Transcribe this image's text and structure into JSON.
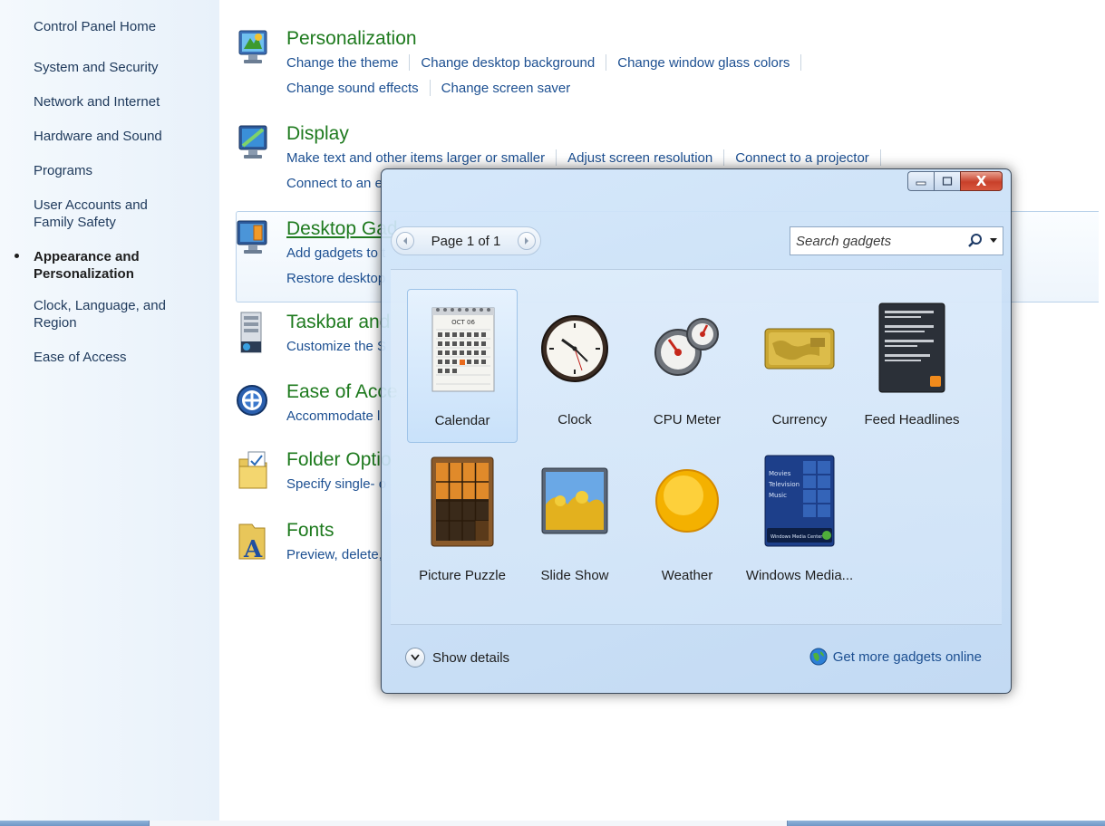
{
  "nav": {
    "items": [
      {
        "label": "Control Panel Home"
      },
      {
        "label": "System and Security"
      },
      {
        "label": "Network and Internet"
      },
      {
        "label": "Hardware and Sound"
      },
      {
        "label": "Programs"
      },
      {
        "label": "User Accounts and Family Safety"
      },
      {
        "label": "Appearance and Personalization",
        "current": true
      },
      {
        "label": "Clock, Language, and Region"
      },
      {
        "label": "Ease of Access"
      }
    ]
  },
  "categories": {
    "personalization": {
      "title": "Personalization",
      "icon": "personalization-icon",
      "links": [
        "Change the theme",
        "Change desktop background",
        "Change window glass colors",
        "Change sound effects",
        "Change screen saver"
      ]
    },
    "display": {
      "title": "Display",
      "icon": "display-icon",
      "links": [
        "Make text and other items larger or smaller",
        "Adjust screen resolution",
        "Connect to a projector",
        "Connect to an e"
      ]
    },
    "gadgets": {
      "title": "Desktop Gad",
      "icon": "desktop-gadgets-icon",
      "links": [
        "Add gadgets to t",
        "Restore desktop"
      ]
    },
    "taskbar": {
      "title": "Taskbar and",
      "icon": "taskbar-icon",
      "links": [
        "Customize the S"
      ]
    },
    "ease": {
      "title": "Ease of Acce",
      "icon": "ease-of-access-icon",
      "links": [
        "Accommodate l"
      ]
    },
    "folder": {
      "title": "Folder Optio",
      "icon": "folder-options-icon",
      "links": [
        "Specify single- o"
      ]
    },
    "fonts": {
      "title": "Fonts",
      "icon": "fonts-icon",
      "links": [
        "Preview, delete,"
      ]
    }
  },
  "gadget_window": {
    "caption_buttons": {
      "close_label": "X"
    },
    "pager": {
      "text": "Page 1 of 1"
    },
    "search": {
      "placeholder": "Search gadgets"
    },
    "gadgets": [
      {
        "label": "Calendar",
        "icon": "calendar-icon",
        "selected": true
      },
      {
        "label": "Clock",
        "icon": "clock-icon"
      },
      {
        "label": "CPU Meter",
        "icon": "cpu-meter-icon"
      },
      {
        "label": "Currency",
        "icon": "currency-icon"
      },
      {
        "label": "Feed Headlines",
        "icon": "feed-headlines-icon"
      },
      {
        "label": "Picture Puzzle",
        "icon": "picture-puzzle-icon"
      },
      {
        "label": "Slide Show",
        "icon": "slide-show-icon"
      },
      {
        "label": "Weather",
        "icon": "weather-icon"
      },
      {
        "label": "Windows Media...",
        "icon": "windows-media-center-icon"
      }
    ],
    "calendar_month": "OCT 06",
    "media_menu": [
      "Movies",
      "Television",
      "Music"
    ],
    "media_badge": "Windows Media Center",
    "footer": {
      "details_label": "Show details",
      "more_label": "Get more gadgets online"
    }
  },
  "colors": {
    "link": "#1c4f91",
    "category_title": "#1e7a1e",
    "close_button": "#c8402a"
  }
}
